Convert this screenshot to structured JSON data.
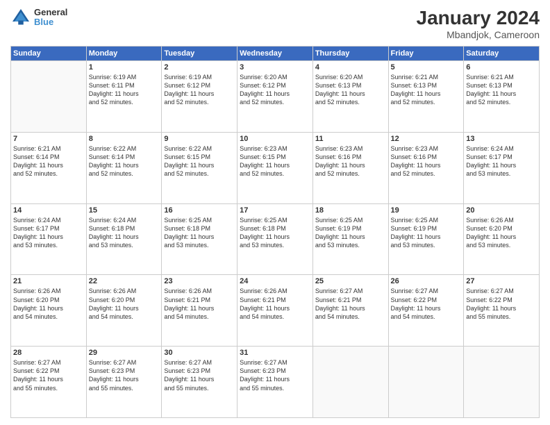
{
  "header": {
    "logo_line1": "General",
    "logo_line2": "Blue",
    "month_year": "January 2024",
    "location": "Mbandjok, Cameroon"
  },
  "weekdays": [
    "Sunday",
    "Monday",
    "Tuesday",
    "Wednesday",
    "Thursday",
    "Friday",
    "Saturday"
  ],
  "weeks": [
    [
      {
        "day": "",
        "info": ""
      },
      {
        "day": "1",
        "info": "Sunrise: 6:19 AM\nSunset: 6:11 PM\nDaylight: 11 hours\nand 52 minutes."
      },
      {
        "day": "2",
        "info": "Sunrise: 6:19 AM\nSunset: 6:12 PM\nDaylight: 11 hours\nand 52 minutes."
      },
      {
        "day": "3",
        "info": "Sunrise: 6:20 AM\nSunset: 6:12 PM\nDaylight: 11 hours\nand 52 minutes."
      },
      {
        "day": "4",
        "info": "Sunrise: 6:20 AM\nSunset: 6:13 PM\nDaylight: 11 hours\nand 52 minutes."
      },
      {
        "day": "5",
        "info": "Sunrise: 6:21 AM\nSunset: 6:13 PM\nDaylight: 11 hours\nand 52 minutes."
      },
      {
        "day": "6",
        "info": "Sunrise: 6:21 AM\nSunset: 6:13 PM\nDaylight: 11 hours\nand 52 minutes."
      }
    ],
    [
      {
        "day": "7",
        "info": "Sunrise: 6:21 AM\nSunset: 6:14 PM\nDaylight: 11 hours\nand 52 minutes."
      },
      {
        "day": "8",
        "info": "Sunrise: 6:22 AM\nSunset: 6:14 PM\nDaylight: 11 hours\nand 52 minutes."
      },
      {
        "day": "9",
        "info": "Sunrise: 6:22 AM\nSunset: 6:15 PM\nDaylight: 11 hours\nand 52 minutes."
      },
      {
        "day": "10",
        "info": "Sunrise: 6:23 AM\nSunset: 6:15 PM\nDaylight: 11 hours\nand 52 minutes."
      },
      {
        "day": "11",
        "info": "Sunrise: 6:23 AM\nSunset: 6:16 PM\nDaylight: 11 hours\nand 52 minutes."
      },
      {
        "day": "12",
        "info": "Sunrise: 6:23 AM\nSunset: 6:16 PM\nDaylight: 11 hours\nand 52 minutes."
      },
      {
        "day": "13",
        "info": "Sunrise: 6:24 AM\nSunset: 6:17 PM\nDaylight: 11 hours\nand 53 minutes."
      }
    ],
    [
      {
        "day": "14",
        "info": "Sunrise: 6:24 AM\nSunset: 6:17 PM\nDaylight: 11 hours\nand 53 minutes."
      },
      {
        "day": "15",
        "info": "Sunrise: 6:24 AM\nSunset: 6:18 PM\nDaylight: 11 hours\nand 53 minutes."
      },
      {
        "day": "16",
        "info": "Sunrise: 6:25 AM\nSunset: 6:18 PM\nDaylight: 11 hours\nand 53 minutes."
      },
      {
        "day": "17",
        "info": "Sunrise: 6:25 AM\nSunset: 6:18 PM\nDaylight: 11 hours\nand 53 minutes."
      },
      {
        "day": "18",
        "info": "Sunrise: 6:25 AM\nSunset: 6:19 PM\nDaylight: 11 hours\nand 53 minutes."
      },
      {
        "day": "19",
        "info": "Sunrise: 6:25 AM\nSunset: 6:19 PM\nDaylight: 11 hours\nand 53 minutes."
      },
      {
        "day": "20",
        "info": "Sunrise: 6:26 AM\nSunset: 6:20 PM\nDaylight: 11 hours\nand 53 minutes."
      }
    ],
    [
      {
        "day": "21",
        "info": "Sunrise: 6:26 AM\nSunset: 6:20 PM\nDaylight: 11 hours\nand 54 minutes."
      },
      {
        "day": "22",
        "info": "Sunrise: 6:26 AM\nSunset: 6:20 PM\nDaylight: 11 hours\nand 54 minutes."
      },
      {
        "day": "23",
        "info": "Sunrise: 6:26 AM\nSunset: 6:21 PM\nDaylight: 11 hours\nand 54 minutes."
      },
      {
        "day": "24",
        "info": "Sunrise: 6:26 AM\nSunset: 6:21 PM\nDaylight: 11 hours\nand 54 minutes."
      },
      {
        "day": "25",
        "info": "Sunrise: 6:27 AM\nSunset: 6:21 PM\nDaylight: 11 hours\nand 54 minutes."
      },
      {
        "day": "26",
        "info": "Sunrise: 6:27 AM\nSunset: 6:22 PM\nDaylight: 11 hours\nand 54 minutes."
      },
      {
        "day": "27",
        "info": "Sunrise: 6:27 AM\nSunset: 6:22 PM\nDaylight: 11 hours\nand 55 minutes."
      }
    ],
    [
      {
        "day": "28",
        "info": "Sunrise: 6:27 AM\nSunset: 6:22 PM\nDaylight: 11 hours\nand 55 minutes."
      },
      {
        "day": "29",
        "info": "Sunrise: 6:27 AM\nSunset: 6:23 PM\nDaylight: 11 hours\nand 55 minutes."
      },
      {
        "day": "30",
        "info": "Sunrise: 6:27 AM\nSunset: 6:23 PM\nDaylight: 11 hours\nand 55 minutes."
      },
      {
        "day": "31",
        "info": "Sunrise: 6:27 AM\nSunset: 6:23 PM\nDaylight: 11 hours\nand 55 minutes."
      },
      {
        "day": "",
        "info": ""
      },
      {
        "day": "",
        "info": ""
      },
      {
        "day": "",
        "info": ""
      }
    ]
  ]
}
